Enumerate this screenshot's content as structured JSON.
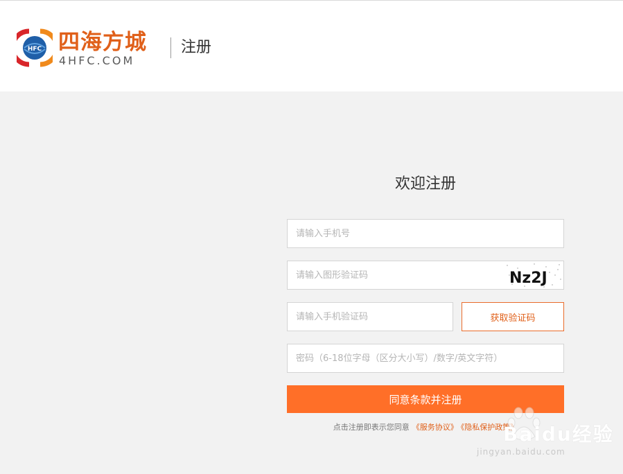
{
  "header": {
    "logo_cn": "四海方城",
    "logo_en": "4HFC.COM",
    "logo_emblem": "HFC",
    "title": "注册"
  },
  "form": {
    "title": "欢迎注册",
    "phone_placeholder": "请输入手机号",
    "captcha_placeholder": "请输入图形验证码",
    "captcha_text": "Nz2J",
    "sms_placeholder": "请输入手机验证码",
    "sms_button": "获取验证码",
    "password_placeholder": "密码（6-18位字母（区分大小写）/数字/英文字符）",
    "submit": "同意条款并注册",
    "terms_prefix": "点击注册即表示您同意",
    "terms_service": "《服务协议》",
    "terms_privacy": "《隐私保护政策》"
  },
  "watermark": {
    "brand": "Baidu经验",
    "url": "jingyan.baidu.com"
  },
  "colors": {
    "accent": "#ff6f28",
    "accent_text": "#e0601a",
    "background": "#f2f2f2"
  }
}
